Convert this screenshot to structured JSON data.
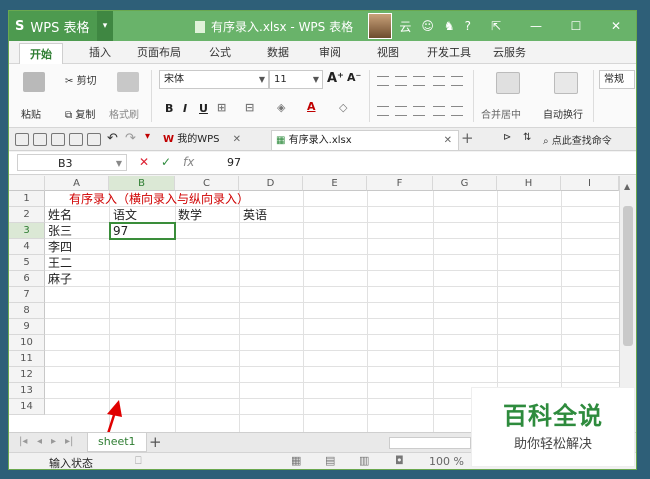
{
  "titlebar": {
    "app_logo": "S",
    "app_name": "WPS 表格",
    "doc_title": "有序录入.xlsx - WPS 表格",
    "user_label": "云",
    "help_label": "?",
    "min_icon": "minimize-icon",
    "max_icon": "maximize-icon",
    "close_icon": "close-icon"
  },
  "ribbon": {
    "tabs": [
      "开始",
      "插入",
      "页面布局",
      "公式",
      "数据",
      "审阅",
      "视图",
      "开发工具",
      "云服务"
    ],
    "paste": "粘贴",
    "cut": "剪切",
    "copy": "复制",
    "format_painter": "格式刷",
    "font_name": "宋体",
    "font_size": "11",
    "bold": "B",
    "italic": "I",
    "underline": "U",
    "font_color": "A",
    "merge_center": "合并居中",
    "wrap_text": "自动换行",
    "number_format": "常规"
  },
  "doc_tabs": {
    "home_tab": "我的WPS",
    "file_tab": "有序录入.xlsx",
    "search_label": "点此查找命令"
  },
  "formula_bar": {
    "name_box": "B3",
    "cancel": "✕",
    "confirm": "✓",
    "fx": "fx",
    "value": "97"
  },
  "grid": {
    "columns": [
      "A",
      "B",
      "C",
      "D",
      "E",
      "F",
      "G",
      "H",
      "I"
    ],
    "active_column": "B",
    "rows": [
      "1",
      "2",
      "3",
      "4",
      "5",
      "6",
      "7",
      "8",
      "9",
      "10",
      "11",
      "12",
      "13",
      "14"
    ],
    "active_row": "3",
    "note": "有序录入（横向录入与纵向录入）",
    "cells": {
      "A2": "姓名",
      "B2": "语文",
      "C2": "数学",
      "D2": "英语",
      "A3": "张三",
      "B3": "97",
      "A4": "李四",
      "A5": "王二",
      "A6": "麻子"
    }
  },
  "sheet_bar": {
    "sheet_name": "sheet1",
    "add": "+"
  },
  "status_bar": {
    "mode": "输入状态",
    "zoom": "100 %"
  },
  "watermark": {
    "title": "百科全说",
    "subtitle": "助你轻松解决"
  },
  "colors": {
    "accent": "#69b36a",
    "selection": "#3a8d3a",
    "note": "#d00000"
  }
}
